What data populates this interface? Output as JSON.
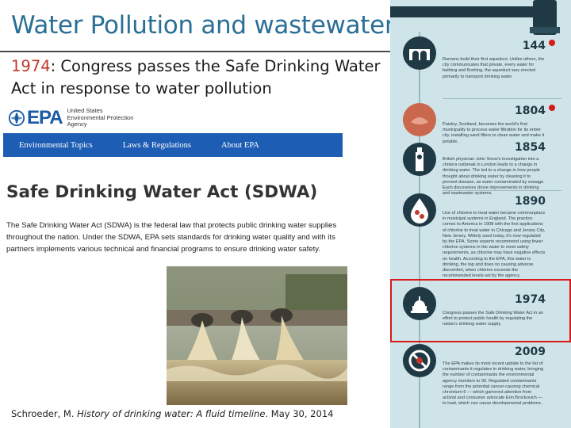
{
  "slide": {
    "title": "Water Pollution and wastewater",
    "subtitle_year": "1974",
    "subtitle_rest": ": Congress passes the Safe Drinking Water Act in response to water pollution"
  },
  "epa": {
    "logo_text": "EPA",
    "agency_line1": "United States",
    "agency_line2": "Environmental Protection",
    "agency_line3": "Agency",
    "nav": [
      "Environmental Topics",
      "Laws & Regulations",
      "About EPA"
    ],
    "heading": "Safe Drinking Water Act (SDWA)",
    "body": "The Safe Drinking Water Act (SDWA) is the federal law that protects public drinking water supplies throughout the nation. Under the SDWA, EPA sets standards for drinking water quality and with its partners implements various technical and financial programs to ensure drinking water safety."
  },
  "citation": {
    "author": "Schroeder, M. ",
    "title": "History of drinking water: A fluid timeline",
    "date": ". May 30, 2014"
  },
  "timeline": {
    "entries": [
      {
        "year": "144",
        "text": "Romans build their first aqueduct. Unlike others, the city communicates that private, every water for bathing and flushing, the aqueduct was erected primarily to transport drinking water."
      },
      {
        "year": "1804",
        "text": "Paisley, Scotland, becomes the world's first municipality to process water filtration for its entire city, installing sand filters to clean water and make it potable."
      },
      {
        "year": "1854",
        "text": "British physician John Snow's investigation into a cholera outbreak in London leads to a change in drinking water. The led to a change in how people thought about drinking water by cleaning it to prevent disease, as water contaminated by sewage. Each discoveries drove improvements in drinking and wastewater systems."
      },
      {
        "year": "1890",
        "text": "Use of chlorine to treat water became commonplace in municipal systems in England. The practice comes to America in 1908 with the first applications of chlorine to treat water in Chicago and Jersey City, New Jersey. Widely used today, it's now regulated by the EPA. Some experts recommend using fewer chlorine systems in the water to meet safety requirements, as chlorine may have negative effects on health. According to the EPA, this water is drinking, the tap and does no causing adverse discomfort, when chlorine exceeds the recommended levels set by the agency."
      },
      {
        "year": "1974",
        "text": "Congress passes the Safe Drinking Water Act in an effort to protect public health by regulating the nation's drinking water supply."
      },
      {
        "year": "2009",
        "text": "The EPA makes its most recent update to the list of contaminants it regulates in drinking water, bringing the number of contaminants the environmental agency monitors to 90. Regulated contaminants range from the potential cancer-causing chemical chromium-6 — which garnered attention from activist and consumer advocate Erin Brockovich — to lead, which can cause developmental problems."
      }
    ]
  },
  "colors": {
    "title": "#2a6f97",
    "year_highlight": "#c0392b",
    "epa_nav": "#1e5db4",
    "highlight_box": "#d7191c",
    "timeline_bg": "#cfe4e8"
  }
}
